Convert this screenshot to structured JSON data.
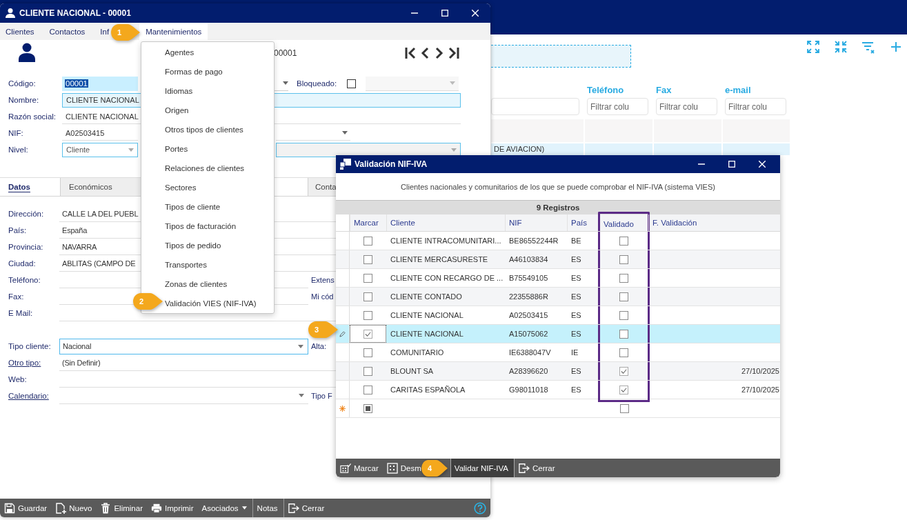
{
  "background_app": {
    "columns": [
      {
        "label": "Teléfono",
        "filter_placeholder": "Filtrar colu"
      },
      {
        "label": "Fax",
        "filter_placeholder": "Filtrar colu"
      },
      {
        "label": "e-mail",
        "filter_placeholder": "Filtrar colu"
      }
    ],
    "row_text": "DE AVIACION)"
  },
  "main_window": {
    "title": "CLIENTE NACIONAL - 00001",
    "menu": [
      {
        "label": "Clientes",
        "selected": false
      },
      {
        "label": "Contactos",
        "selected": false
      },
      {
        "label": "Inf",
        "selected": false
      },
      {
        "label": "Mantenimientos",
        "selected": true
      }
    ],
    "record_code": "00001",
    "header": {
      "codigo_label": "Código:",
      "codigo": "00001",
      "bloqueado_label": "Bloqueado:",
      "bloqueado": false,
      "nombre_label": "Nombre:",
      "nombre": "CLIENTE NACIONAL",
      "razon_label": "Razón social:",
      "razon": "CLIENTE NACIONAL",
      "nif_label": "NIF:",
      "nif": "A02503415",
      "nivel_label": "Nivel:",
      "nivel": "Cliente"
    },
    "tabs": [
      {
        "label": "Datos",
        "selected": true
      },
      {
        "label": "Económicos",
        "selected": false
      },
      {
        "label": "Conta",
        "selected": false
      }
    ],
    "contact_fields": [
      {
        "label": "Dirección:",
        "value": "CALLE LA DEL PUEBL"
      },
      {
        "label": "País:",
        "value": "España"
      },
      {
        "label": "Provincia:",
        "value": "NAVARRA"
      },
      {
        "label": "Ciudad:",
        "value": "ABLITAS (CAMPO DE"
      },
      {
        "label": "Teléfono:",
        "side_label": "Extens"
      },
      {
        "label": "Fax:",
        "side_label": "Mi cód"
      },
      {
        "label": "E Mail:"
      }
    ],
    "class_fields": [
      {
        "label": "Tipo cliente:",
        "value": "Nacional",
        "kind": "select_box",
        "link": false,
        "side_label": "Alta:"
      },
      {
        "label": "Otro tipo:",
        "value": "(Sin Definir)",
        "kind": "text",
        "link": true
      },
      {
        "label": "Web:",
        "kind": "text",
        "link": false
      },
      {
        "label": "Calendario:",
        "kind": "select",
        "link": true,
        "side_label": "Tipo F"
      }
    ],
    "toolbar": [
      {
        "label": "Guardar",
        "kind": "save"
      },
      {
        "label": "Nuevo",
        "kind": "new"
      },
      {
        "label": "Eliminar",
        "kind": "delete"
      },
      {
        "label": "Imprimir",
        "kind": "print"
      },
      {
        "label": "Asociados",
        "kind": "menu"
      },
      {
        "label": "Notas",
        "kind": "plain"
      },
      {
        "label": "Cerrar",
        "kind": "exit"
      }
    ]
  },
  "dropdown_menu": [
    "Agentes",
    "Formas de pago",
    "Idiomas",
    "Origen",
    "Otros tipos de clientes",
    "Portes",
    "Relaciones de clientes",
    "Sectores",
    "Tipos de cliente",
    "Tipos de facturación",
    "Tipos de pedido",
    "Transportes",
    "Zonas de clientes",
    "Validación VIES (NIF-IVA)"
  ],
  "dialog": {
    "title": "Validación NIF-IVA",
    "subtitle": "Clientes nacionales y comunitarios de los que se puede comprobar el NIF-IVA (sistema VIES)",
    "record_count": "9 Registros",
    "columns": [
      {
        "label": "Marcar",
        "highlighted": false
      },
      {
        "label": "Cliente",
        "highlighted": false
      },
      {
        "label": "NIF",
        "highlighted": false
      },
      {
        "label": "País",
        "highlighted": false
      },
      {
        "label": "Validado",
        "highlighted": true
      },
      {
        "label": "F. Validación",
        "highlighted": false
      }
    ],
    "rows": [
      {
        "cliente": "CLIENTE INTRACOMUNITARI...",
        "nif": "BE86552244R",
        "pais": "BE",
        "marcar": false,
        "validado": false,
        "selected": false
      },
      {
        "cliente": "CLIENTE MERCASURESTE",
        "nif": "A46103834",
        "pais": "ES",
        "marcar": false,
        "validado": false,
        "selected": false
      },
      {
        "cliente": "CLIENTE CON RECARGO DE ...",
        "nif": "B75549105",
        "pais": "ES",
        "marcar": false,
        "validado": false,
        "selected": false
      },
      {
        "cliente": "CLIENTE CONTADO",
        "nif": "22355886R",
        "pais": "ES",
        "marcar": false,
        "validado": false,
        "selected": false
      },
      {
        "cliente": "CLIENTE NACIONAL",
        "nif": "A02503415",
        "pais": "ES",
        "marcar": false,
        "validado": false,
        "selected": false
      },
      {
        "cliente": "CLIENTE NACIONAL",
        "nif": "A15075062",
        "pais": "ES",
        "marcar": true,
        "validado": false,
        "selected": true
      },
      {
        "cliente": "COMUNITARIO",
        "nif": "IE6388047V",
        "pais": "IE",
        "marcar": false,
        "validado": false,
        "selected": false
      },
      {
        "cliente": "BLOUNT SA",
        "nif": "A28396620",
        "pais": "ES",
        "marcar": false,
        "validado": true,
        "selected": false,
        "fecha": "27/10/2025"
      },
      {
        "cliente": "CARITAS ESPAÑOLA",
        "nif": "G98011018",
        "pais": "ES",
        "marcar": false,
        "validado": true,
        "selected": false,
        "fecha": "27/10/2025"
      }
    ],
    "new_row": {
      "marked_partial": true,
      "validado": false
    },
    "toolbar": [
      {
        "label": "Marcar",
        "kind": "mark",
        "active": false
      },
      {
        "label": "Desm",
        "kind": "unmark",
        "active": false
      },
      {
        "label": "Validar NIF-IVA",
        "kind": "plain",
        "active": true
      },
      {
        "label": "Cerrar",
        "kind": "exit",
        "active": false
      }
    ]
  },
  "callouts": [
    {
      "number": "1"
    },
    {
      "number": "2"
    },
    {
      "number": "3"
    },
    {
      "number": "4"
    }
  ]
}
